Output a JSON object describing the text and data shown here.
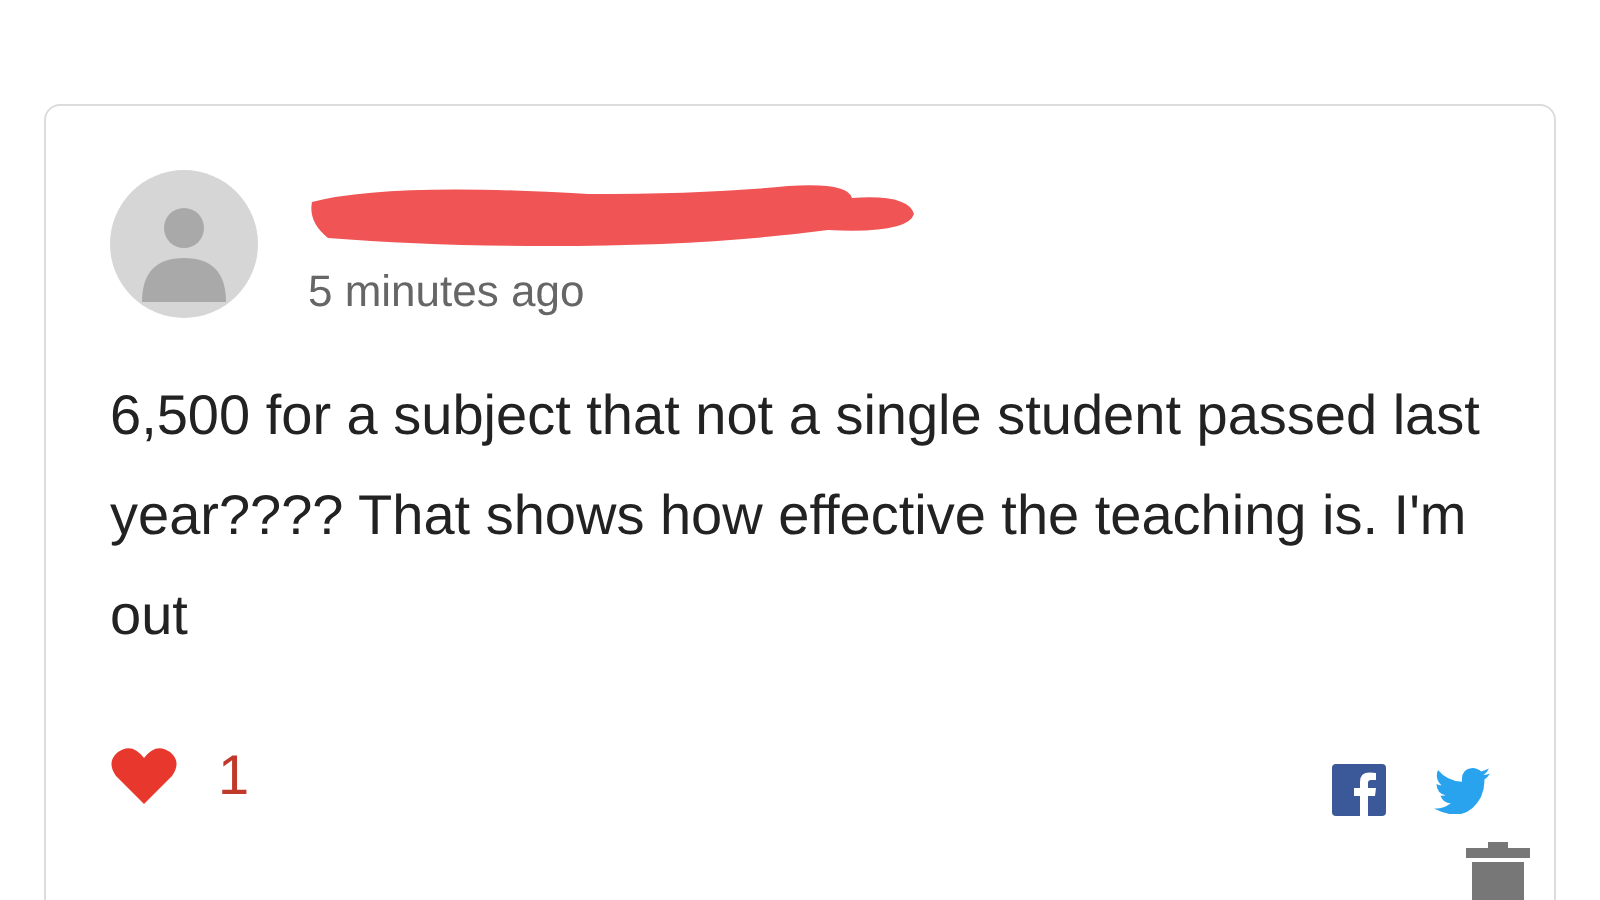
{
  "comment": {
    "author_redacted": true,
    "time": "5 minutes ago",
    "body": "6,500 for a subject that not a single student passed last year???? That shows how effective the teaching is. I'm out",
    "liked": true,
    "likes": "1"
  }
}
